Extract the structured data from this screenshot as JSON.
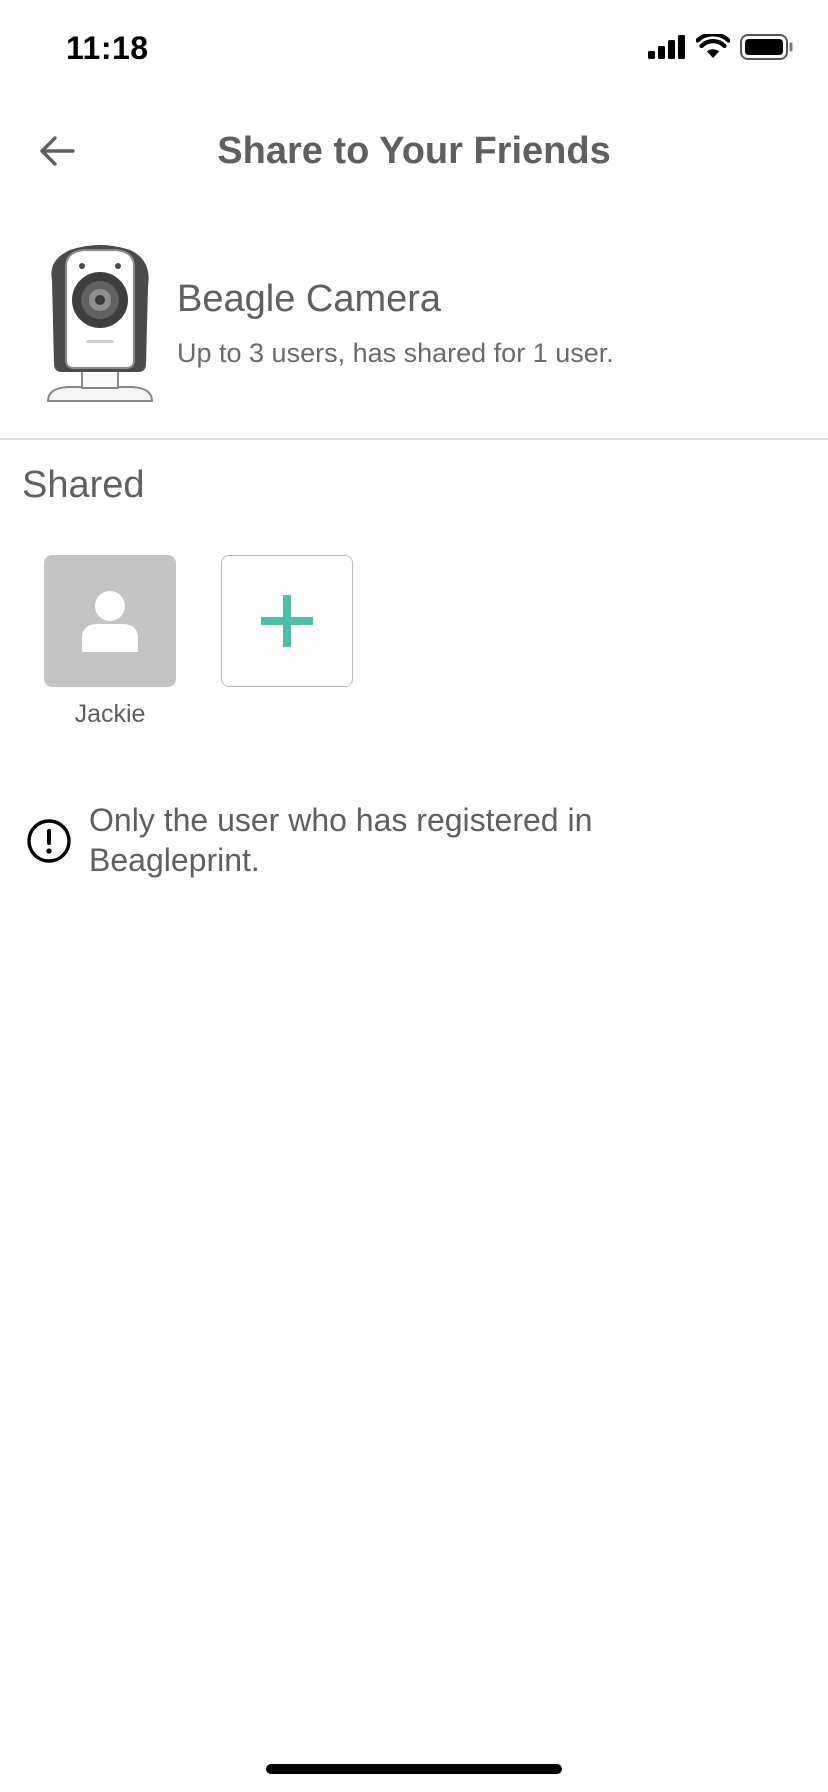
{
  "status_bar": {
    "time": "11:18"
  },
  "nav": {
    "title": "Share to Your Friends"
  },
  "device": {
    "name": "Beagle Camera",
    "description": "Up to 3 users, has shared for 1 user."
  },
  "shared": {
    "section_title": "Shared",
    "users": [
      {
        "name": "Jackie"
      }
    ]
  },
  "notice": {
    "text": "Only the user who has registered in Beagleprint."
  },
  "colors": {
    "accent": "#4cbfa6",
    "text": "#5f5f5f",
    "avatar_bg": "#c4c4c4",
    "divider": "#dcdcdc"
  },
  "icons": {
    "back": "arrow-left-icon",
    "add": "plus-icon",
    "avatar": "person-icon",
    "notice": "exclamation-circle-icon",
    "signal": "cellular-signal-icon",
    "wifi": "wifi-icon",
    "battery": "battery-icon"
  }
}
